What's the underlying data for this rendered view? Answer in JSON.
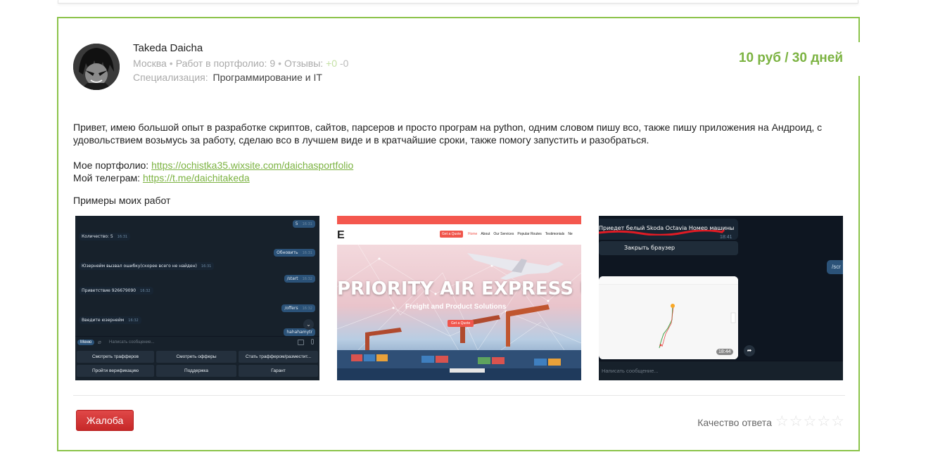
{
  "offer": {
    "user_name": "Takeda Daicha",
    "city": "Москва",
    "portfolio_label": "Работ в портфолио:",
    "portfolio_count": "9",
    "reviews_label": "Отзывы:",
    "reviews_positive": "+0",
    "reviews_negative": "-0",
    "spec_label": "Специализация:",
    "spec_value": "Программирование и IT",
    "price": "10 руб / 30 дней",
    "description": "Привет, имею большой опыт в разработке скриптов, сайтов, парсеров и просто програм на python, одним словом пишу всо, также пишу приложения на Андроид, с удовольствием возьмусь за работу, сделаю всо в лучшем виде и в кратчайшие сроки, также помогу запустить и разобраться.",
    "portfolio_link_label": "Мое портфолио:",
    "portfolio_link": "https://ochistka35.wixsite.com/daichasportfolio",
    "telegram_link_label": "Мой телеграм:",
    "telegram_link": "https://t.me/daichitakeda",
    "examples_title": "Примеры моих работ",
    "complain_button": "Жалоба",
    "quality_label": "Качество ответа",
    "rating_stars": 5,
    "rating_value": 0,
    "accent_color": "#8bc34a"
  },
  "shot1": {
    "messages": [
      {
        "dir": "out",
        "text": "5",
        "time": "16:31"
      },
      {
        "dir": "in",
        "text": "Количество: 5",
        "time": "16:31"
      },
      {
        "dir": "out",
        "text": "Обновить",
        "time": "16:31"
      },
      {
        "dir": "in",
        "text": "Юзернейм вызвал ошибку(скорее всего не найден)",
        "time": "16:31"
      },
      {
        "dir": "out",
        "text": "/start",
        "time": "16:32"
      },
      {
        "dir": "in",
        "text": "Приветствие 926679090",
        "time": "16:32"
      },
      {
        "dir": "out",
        "text": "/offers",
        "time": "16:32"
      },
      {
        "dir": "in",
        "text": "Введите юзернейм",
        "time": "16:32"
      },
      {
        "dir": "out",
        "text": "hahahamytr",
        "time": ""
      }
    ],
    "menu_button": "Меню",
    "input_placeholder": "Написать сообщение...",
    "keyboard": [
      "Смотреть трафферов",
      "Смотреть офферы",
      "Стать траффером/разместит...",
      "Пройти верификацию",
      "Поддержка",
      "Гарант"
    ]
  },
  "shot2": {
    "logo": "E",
    "quote_button": "Get a Quote",
    "menu": [
      "Home",
      "About",
      "Our Services",
      "Popular Routes",
      "Testimonials",
      "Ne"
    ],
    "title": "PRIORITY AIR EXPRESS UK",
    "subtitle": "Freight and Product Solutions",
    "cta": "Get a Quote"
  },
  "shot3": {
    "message": "Приедет белый Skoda Octavia Номер машины",
    "time": "18:41",
    "button": "Закрыть браузер",
    "command": "/scr",
    "map_time": "18:44",
    "input_placeholder": "Написать сообщение..."
  }
}
